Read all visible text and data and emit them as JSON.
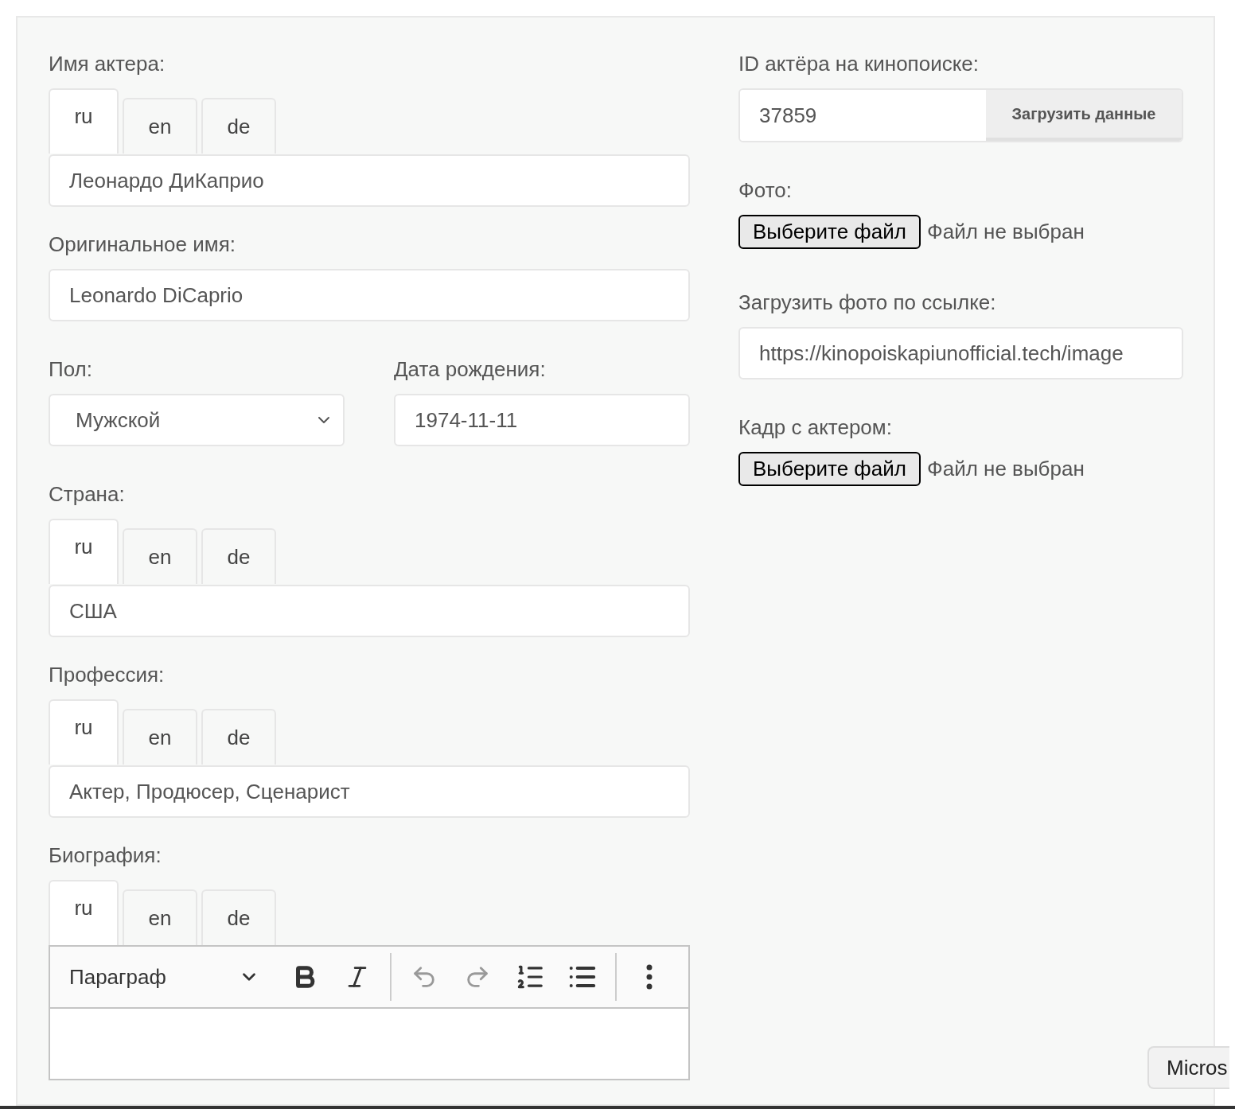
{
  "left_fields": [
    {
      "kind": "tabbed_input",
      "label": "Имя актера:",
      "tabs": [
        {
          "label": "ru",
          "selected": true
        },
        {
          "label": "en",
          "selected": false
        },
        {
          "label": "de",
          "selected": false
        }
      ],
      "value": "Леонардо ДиКаприо"
    },
    {
      "kind": "input",
      "label": "Оригинальное имя:",
      "value": "Leonardo DiCaprio"
    },
    {
      "kind": "row",
      "fields": [
        {
          "kind": "select",
          "label": "Пол:",
          "value": "Мужской"
        },
        {
          "kind": "input",
          "label": "Дата рождения:",
          "value": "1974-11-11"
        }
      ]
    },
    {
      "kind": "tabbed_input",
      "label": "Страна:",
      "tabs": [
        {
          "label": "ru",
          "selected": true
        },
        {
          "label": "en",
          "selected": false
        },
        {
          "label": "de",
          "selected": false
        }
      ],
      "value": "США"
    },
    {
      "kind": "tabbed_input",
      "label": "Профессия:",
      "tabs": [
        {
          "label": "ru",
          "selected": true
        },
        {
          "label": "en",
          "selected": false
        },
        {
          "label": "de",
          "selected": false
        }
      ],
      "value": "Актер, Продюсер, Сценарист"
    },
    {
      "kind": "tabbed_editor",
      "label": "Биография:",
      "tabs": [
        {
          "label": "ru",
          "selected": true
        },
        {
          "label": "en",
          "selected": false
        },
        {
          "label": "de",
          "selected": false
        }
      ],
      "block_format": "Параграф",
      "toolbar": [
        {
          "kind": "bold",
          "disabled": false
        },
        {
          "kind": "italic",
          "disabled": false
        },
        {
          "kind": "separator"
        },
        {
          "kind": "undo",
          "disabled": true
        },
        {
          "kind": "redo",
          "disabled": true
        },
        {
          "kind": "numbered_list",
          "disabled": false
        },
        {
          "kind": "bulleted_list",
          "disabled": false
        },
        {
          "kind": "separator"
        },
        {
          "kind": "more",
          "disabled": false
        }
      ]
    }
  ],
  "right_fields": [
    {
      "kind": "input_button",
      "label": "ID актёра на кинопоиске:",
      "value": "37859",
      "button": "Загрузить данные"
    },
    {
      "kind": "file",
      "label": "Фото:",
      "button": "Выберите файл",
      "status": "Файл не выбран"
    },
    {
      "kind": "input",
      "label": "Загрузить фото по ссылке:",
      "value": "https://kinopoiskapiunofficial.tech/image"
    },
    {
      "kind": "file",
      "label": "Кадр с актером:",
      "button": "Выберите файл",
      "status": "Файл не выбран"
    }
  ],
  "tooltip": "Micros"
}
